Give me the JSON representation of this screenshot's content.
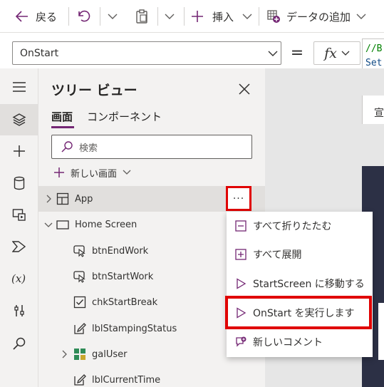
{
  "toolbar": {
    "back_label": "戻る",
    "insert_label": "挿入",
    "add_data_label": "データの追加"
  },
  "formula": {
    "property_value": "OnStart",
    "equals": "=",
    "fx_label": "fx",
    "code_line_1": "//B",
    "code_line_2": "Set",
    "canvas_strip_text": "宣"
  },
  "tree_panel": {
    "title": "ツリー ビュー",
    "tabs": [
      {
        "label": "画面",
        "active": true
      },
      {
        "label": "コンポーネント",
        "active": false
      }
    ],
    "search_placeholder": "検索",
    "new_screen_label": "新しい画面",
    "more_button_label": "···",
    "rows": [
      {
        "label": "App",
        "icon": "app-icon",
        "selected": true
      },
      {
        "label": "Home Screen",
        "icon": "screen-icon",
        "expanded": true
      },
      {
        "label": "btnEndWork",
        "icon": "button-icon"
      },
      {
        "label": "btnStartWork",
        "icon": "button-icon"
      },
      {
        "label": "chkStartBreak",
        "icon": "checkbox-icon"
      },
      {
        "label": "lblStampingStatus",
        "icon": "label-icon"
      },
      {
        "label": "galUser",
        "icon": "gallery-icon"
      },
      {
        "label": "lblCurrentTime",
        "icon": "label-icon"
      }
    ]
  },
  "context_menu": {
    "items": [
      {
        "label": "すべて折りたたむ",
        "icon": "collapse-all-icon"
      },
      {
        "label": "すべて展開",
        "icon": "expand-all-icon"
      },
      {
        "label": "StartScreen に移動する",
        "icon": "play-icon"
      },
      {
        "label": "OnStart を実行します",
        "icon": "play-icon",
        "highlighted": true
      },
      {
        "label": "新しいコメント",
        "icon": "new-comment-icon"
      }
    ]
  },
  "colors": {
    "accent_purple": "#742774",
    "highlight_red": "#e00000",
    "canvas_dark": "#2c3045"
  }
}
